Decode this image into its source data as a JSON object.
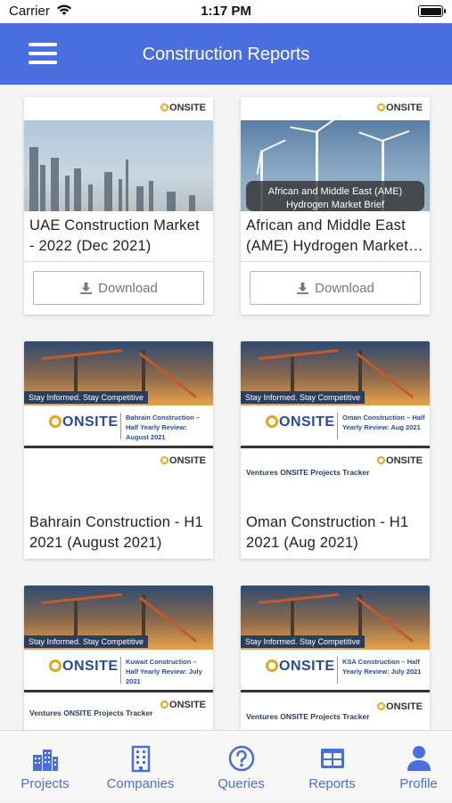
{
  "status_bar": {
    "carrier": "Carrier",
    "time": "1:17 PM"
  },
  "header": {
    "title": "Construction Reports"
  },
  "cards": [
    {
      "title": "UAE Construction Market - 2022 (Dec 2021)",
      "download_label": "Download",
      "logo": "ONSITE"
    },
    {
      "title": "African and Middle East (AME) Hydrogen Market…",
      "download_label": "Download",
      "logo": "ONSITE",
      "image_caption": "African and Middle East (AME) Hydrogen Market Brief"
    },
    {
      "title": "Bahrain Construction - H1 2021 (August 2021)",
      "logo": "ONSITE",
      "image_tagline": "Stay Informed. Stay Competitive",
      "image_brand": "ONSITE",
      "image_report_title": "Bahrain Construction – Half Yearly Review: August 2021"
    },
    {
      "title": "Oman Construction - H1 2021 (Aug 2021)",
      "logo": "ONSITE",
      "image_tagline": "Stay Informed. Stay Competitive",
      "image_brand": "ONSITE",
      "image_report_title": "Oman Construction – Half Yearly Review: Aug 2021",
      "tracker_label": "Ventures ONSITE Projects Tracker"
    },
    {
      "logo": "ONSITE",
      "image_tagline": "Stay Informed. Stay Competitive",
      "image_brand": "ONSITE",
      "image_report_title": "Kuwait Construction – Half Yearly Review: July 2021",
      "tracker_label": "Ventures ONSITE Projects Tracker"
    },
    {
      "logo": "ONSITE",
      "image_tagline": "Stay Informed. Stay Competitive",
      "image_brand": "ONSITE",
      "image_report_title": "KSA Construction – Half Yearly Review: July 2021",
      "tracker_label": "Ventures ONSITE Projects Tracker"
    }
  ],
  "tabs": [
    {
      "label": "Projects",
      "icon": "buildings-icon"
    },
    {
      "label": "Companies",
      "icon": "office-building-icon"
    },
    {
      "label": "Queries",
      "icon": "question-circle-icon"
    },
    {
      "label": "Reports",
      "icon": "reports-grid-icon"
    },
    {
      "label": "Profile",
      "icon": "person-icon"
    }
  ],
  "colors": {
    "primary": "#4a6ee0",
    "tab_active": "#4a6ee0",
    "background": "#f3f3f3"
  }
}
